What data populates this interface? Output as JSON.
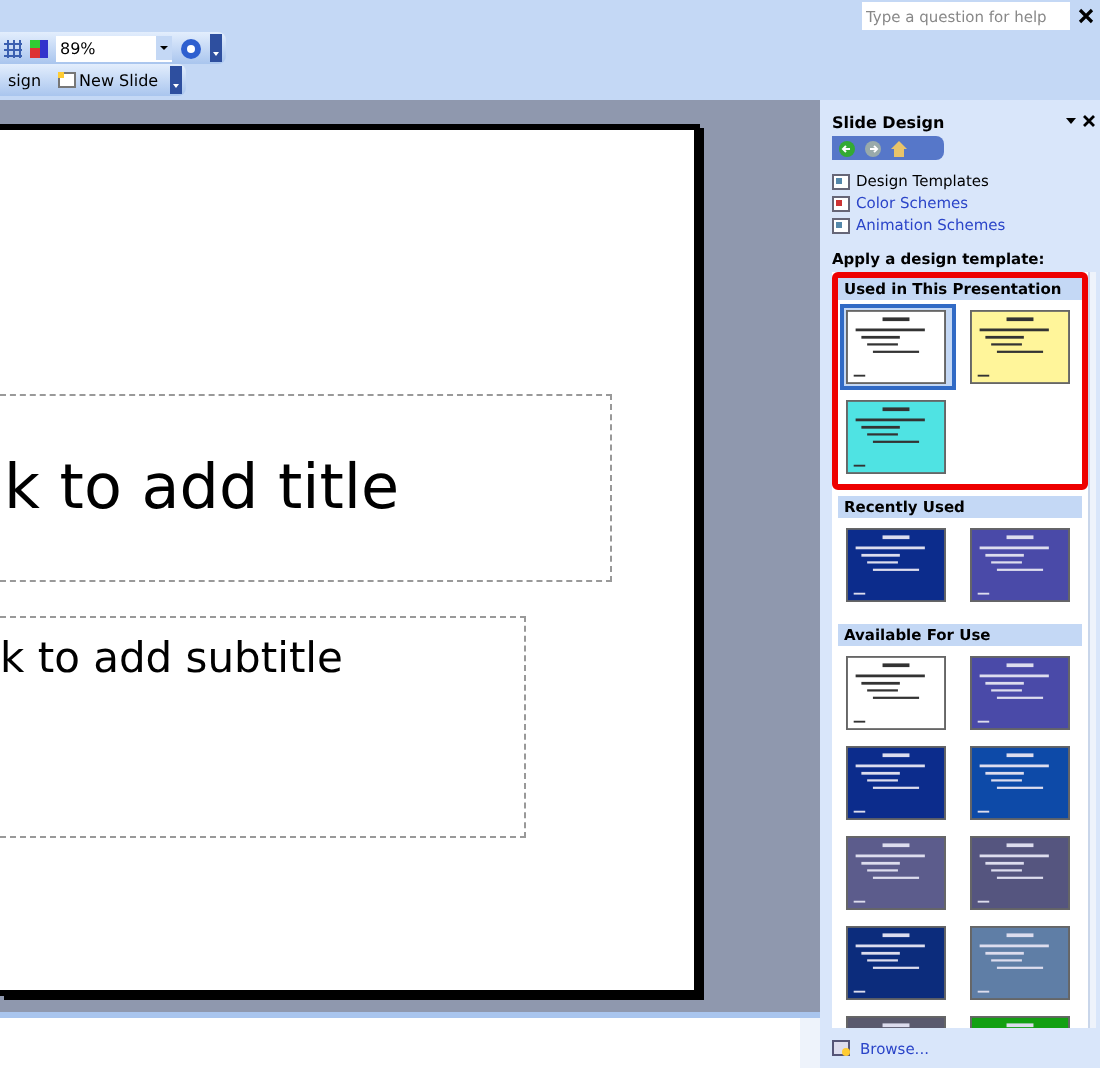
{
  "help_box": {
    "placeholder": "Type a question for help"
  },
  "toolbar": {
    "zoom": "89%"
  },
  "formatting_toolbar": {
    "buttons": [
      "sign",
      "New Slide"
    ]
  },
  "slide": {
    "title_placeholder": "k to add title",
    "subtitle_placeholder": "k to add subtitle"
  },
  "task_pane": {
    "title": "Slide Design",
    "links": [
      {
        "label": "Design Templates",
        "kind": "plain"
      },
      {
        "label": "Color Schemes",
        "kind": "link"
      },
      {
        "label": "Animation Schemes",
        "kind": "link"
      }
    ],
    "heading": "Apply a design template:",
    "sections": [
      {
        "title": "Used in This Presentation",
        "highlighted": true,
        "templates": [
          {
            "color": "#ffffff",
            "selected": true
          },
          {
            "color": "#fff59a",
            "selected": false
          },
          {
            "color": "#4fe3e3",
            "selected": false
          }
        ]
      },
      {
        "title": "Recently Used",
        "highlighted": false,
        "templates": [
          {
            "color": "#0c2c8c",
            "selected": false
          },
          {
            "color": "#4a4aa8",
            "selected": false
          }
        ]
      },
      {
        "title": "Available For Use",
        "highlighted": false,
        "templates": [
          {
            "color": "#ffffff",
            "selected": false
          },
          {
            "color": "#4a4aa8",
            "selected": false
          },
          {
            "color": "#0c2c8c",
            "selected": false
          },
          {
            "color": "#0d4aa8",
            "selected": false
          },
          {
            "color": "#5c5c8c",
            "selected": false
          },
          {
            "color": "#55557f",
            "selected": false
          },
          {
            "color": "#0c2c7c",
            "selected": false
          },
          {
            "color": "#5f7ea6",
            "selected": false
          },
          {
            "color": "#5a5a6e",
            "selected": false
          },
          {
            "color": "#12a012",
            "selected": false
          }
        ]
      }
    ],
    "browse": "Browse..."
  }
}
